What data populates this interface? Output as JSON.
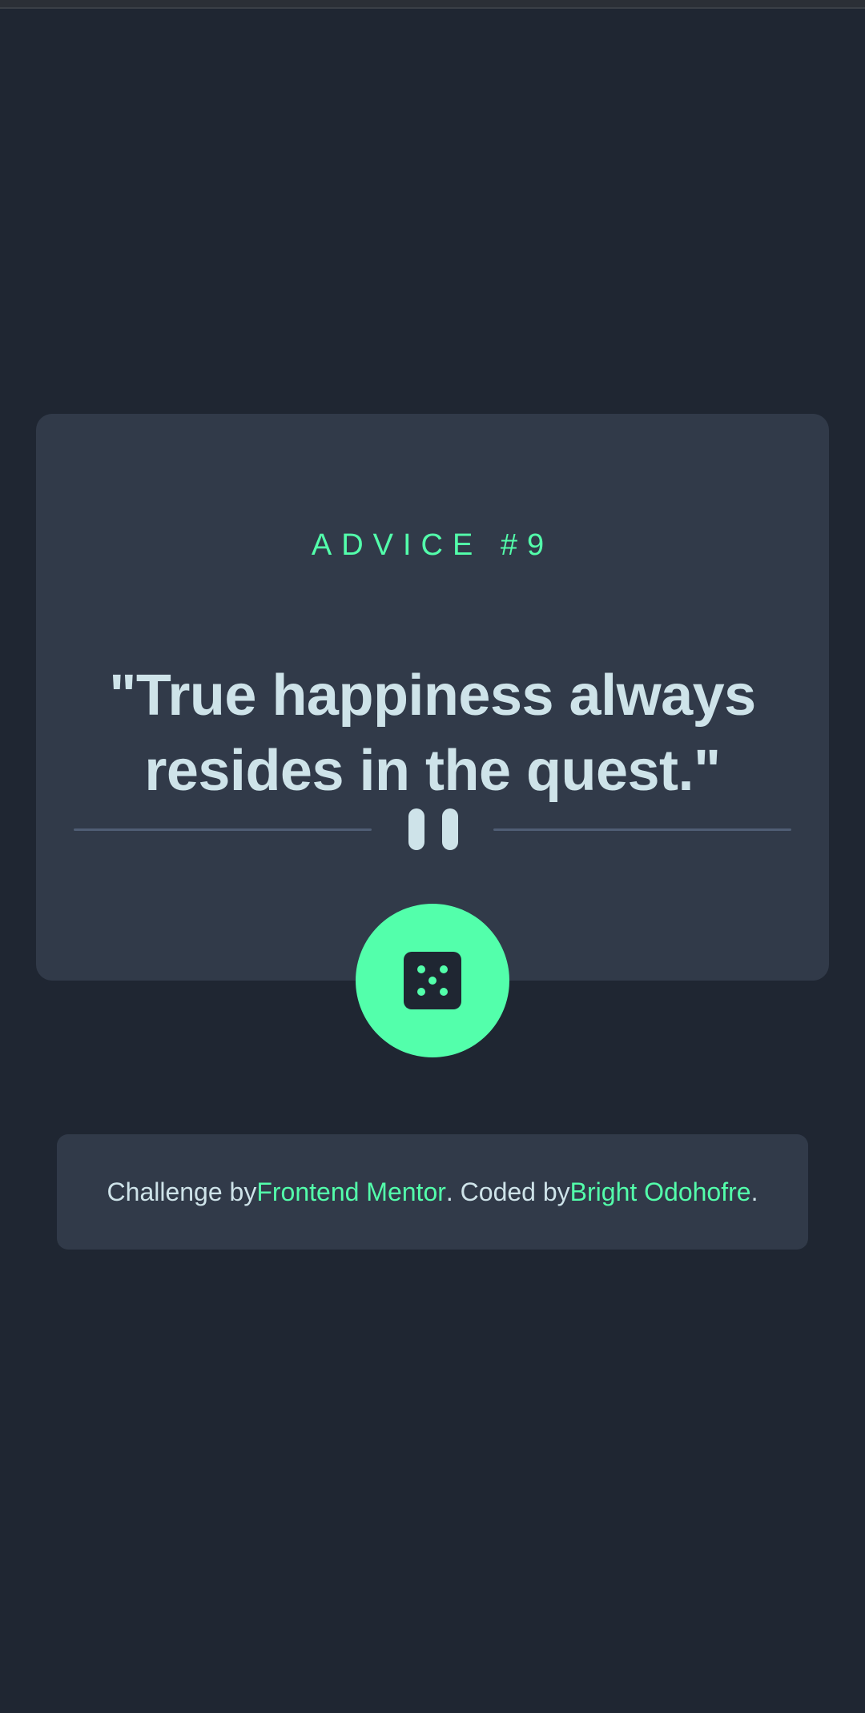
{
  "card": {
    "advice_id": "ADVICE #9",
    "quote": "\"True happiness always resides in the quest.\""
  },
  "dice_button": {
    "icon": "dice-icon"
  },
  "footer": {
    "prefix": "Challenge by ",
    "challenge_link": "Frontend Mentor",
    "middle": ". Coded by ",
    "author_link": "Bright Odohofre",
    "suffix": "."
  },
  "colors": {
    "background": "#1f2632",
    "card": "#313a49",
    "accent": "#53ffab",
    "text": "#cee3e9",
    "divider": "#4f5d74"
  }
}
